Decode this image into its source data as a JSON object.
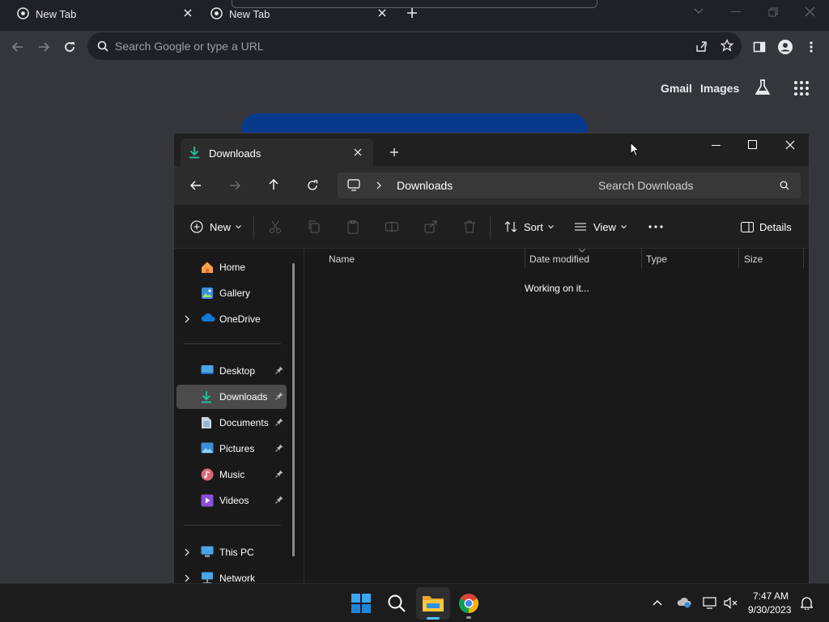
{
  "browser": {
    "tabs": [
      {
        "title": "New Tab",
        "active": false
      },
      {
        "title": "New Tab",
        "active": true
      }
    ],
    "omnibox_placeholder": "Search Google or type a URL",
    "ntp_links": {
      "gmail": "Gmail",
      "images": "Images"
    }
  },
  "explorer": {
    "tab_title": "Downloads",
    "breadcrumb": "Downloads",
    "search_placeholder": "Search Downloads",
    "commands": {
      "new": "New",
      "sort": "Sort",
      "view": "View",
      "details": "Details"
    },
    "nav": {
      "home": "Home",
      "gallery": "Gallery",
      "onedrive": "OneDrive",
      "desktop": "Desktop",
      "downloads": "Downloads",
      "documents": "Documents",
      "pictures": "Pictures",
      "music": "Music",
      "videos": "Videos",
      "thispc": "This PC",
      "network": "Network"
    },
    "columns": {
      "name": "Name",
      "date": "Date modified",
      "type": "Type",
      "size": "Size"
    },
    "status": "Working on it..."
  },
  "taskbar": {
    "time": "7:47 AM",
    "date": "9/30/2023"
  },
  "colors": {
    "accent": "#0067c0",
    "chrome_bg": "#35363a",
    "explorer_bg": "#191919"
  }
}
